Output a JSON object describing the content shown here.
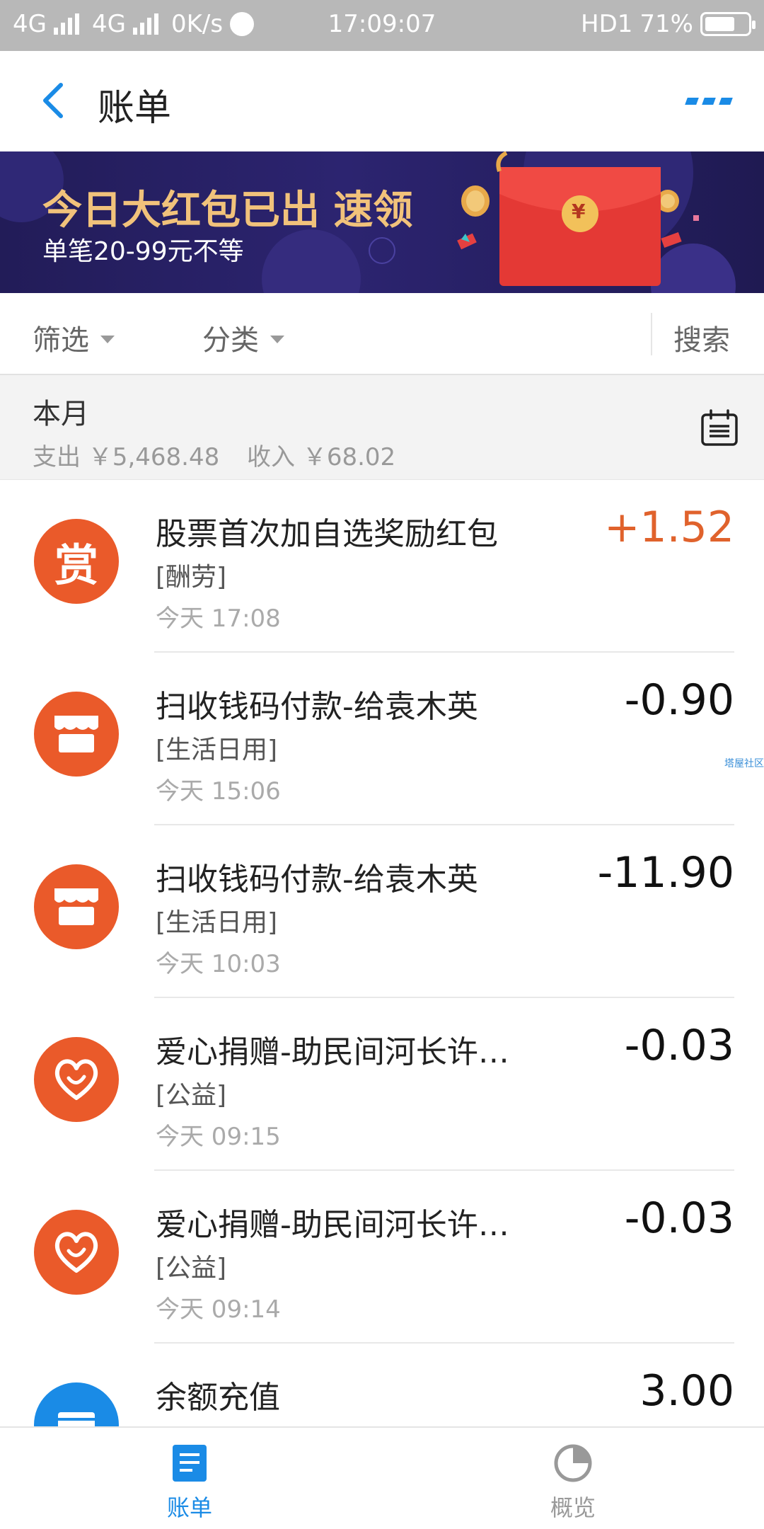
{
  "status_bar": {
    "net1": "4G",
    "net2": "4G",
    "speed": "0K/s",
    "time": "17:09:07",
    "hd": "HD1",
    "battery": "71%"
  },
  "header": {
    "title": "账单"
  },
  "banner": {
    "title": "今日大红包已出 速领",
    "subtitle": "单笔20-99元不等",
    "envelope_symbol": "¥"
  },
  "filters": {
    "filter_label": "筛选",
    "category_label": "分类",
    "search_label": "搜索"
  },
  "month_summary": {
    "label": "本月",
    "expense": "支出 ￥5,468.48",
    "income": "收入 ￥68.02"
  },
  "transactions": [
    {
      "icon": "reward-icon",
      "icon_text": "赏",
      "name": "股票首次加自选奖励红包",
      "category": "[酬劳]",
      "time": "今天  17:08",
      "amount": "+1.52",
      "positive": true
    },
    {
      "icon": "shop-icon",
      "name": "扫收钱码付款-给袁木英",
      "category": "[生活日用]",
      "time": "今天  15:06",
      "amount": "-0.90",
      "positive": false
    },
    {
      "icon": "shop-icon",
      "name": "扫收钱码付款-给袁木英",
      "category": "[生活日用]",
      "time": "今天  10:03",
      "amount": "-11.90",
      "positive": false
    },
    {
      "icon": "charity-heart-icon",
      "name": "爱心捐赠-助民间河长许…",
      "category": "[公益]",
      "time": "今天  09:15",
      "amount": "-0.03",
      "positive": false
    },
    {
      "icon": "charity-heart-icon",
      "name": "爱心捐赠-助民间河长许…",
      "category": "[公益]",
      "time": "今天  09:14",
      "amount": "-0.03",
      "positive": false
    },
    {
      "icon": "wallet-icon",
      "name": "余额充值",
      "category": "",
      "time": "",
      "amount": "3.00",
      "positive": false
    }
  ],
  "watermark": "塔屋社区",
  "tabbar": {
    "bill_label": "账单",
    "overview_label": "概览"
  },
  "colors": {
    "accent": "#1a8be6",
    "icon_orange": "#ea5a2a",
    "income": "#e0622c",
    "banner_bg": "#2a2268",
    "banner_gold": "#f1c27b"
  }
}
